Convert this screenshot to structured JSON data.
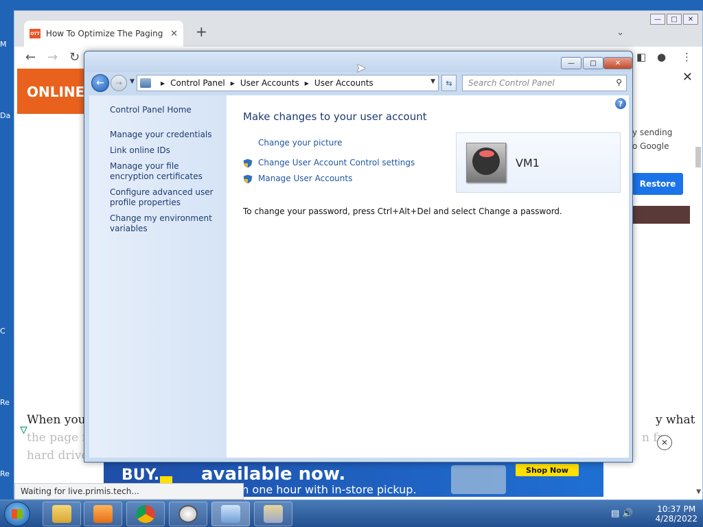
{
  "desktop": {
    "left_letters": [
      "M",
      "Da",
      "C",
      "Re",
      "Re"
    ]
  },
  "browser": {
    "tab_title": "How To Optimize The Paging File",
    "tab_close": "✕",
    "favicon_text": "OTT",
    "new_tab": "+",
    "status_text": "Waiting for live.primis.tech...",
    "page": {
      "logo_text": "ONLINE",
      "side_text_1": "y sending",
      "side_text_2": "o Google",
      "restore_label": "Restore",
      "article_line_1": "When your",
      "article_line_1_right": "y what",
      "article_line_2": "the page fil",
      "article_line_2_right": "n fr",
      "article_line_3": "hard drive",
      "ad": {
        "buy": "BUY.",
        "headline": "available now.",
        "subline": "Ready in one hour with in-store pickup.",
        "shop_now": "Shop Now"
      }
    }
  },
  "control_panel": {
    "breadcrumb": [
      "Control Panel",
      "User Accounts",
      "User Accounts"
    ],
    "search_placeholder": "Search Control Panel",
    "left_nav": {
      "home": "Control Panel Home",
      "items": [
        "Manage your credentials",
        "Link online IDs",
        "Manage your file encryption certificates",
        "Configure advanced user profile properties",
        "Change my environment variables"
      ]
    },
    "heading": "Make changes to your user account",
    "tasks": [
      "Change your picture",
      "Change User Account Control settings",
      "Manage User Accounts"
    ],
    "password_note": "To change your password, press Ctrl+Alt+Del and select Change a password.",
    "account_name": "VM1"
  },
  "taskbar": {
    "time": "10:37 PM",
    "date": "4/28/2022",
    "apps": [
      "explorer-icon",
      "media-player-icon",
      "chrome-icon",
      "clock-gadget-icon",
      "control-panel-icon",
      "user-accounts-icon"
    ]
  }
}
